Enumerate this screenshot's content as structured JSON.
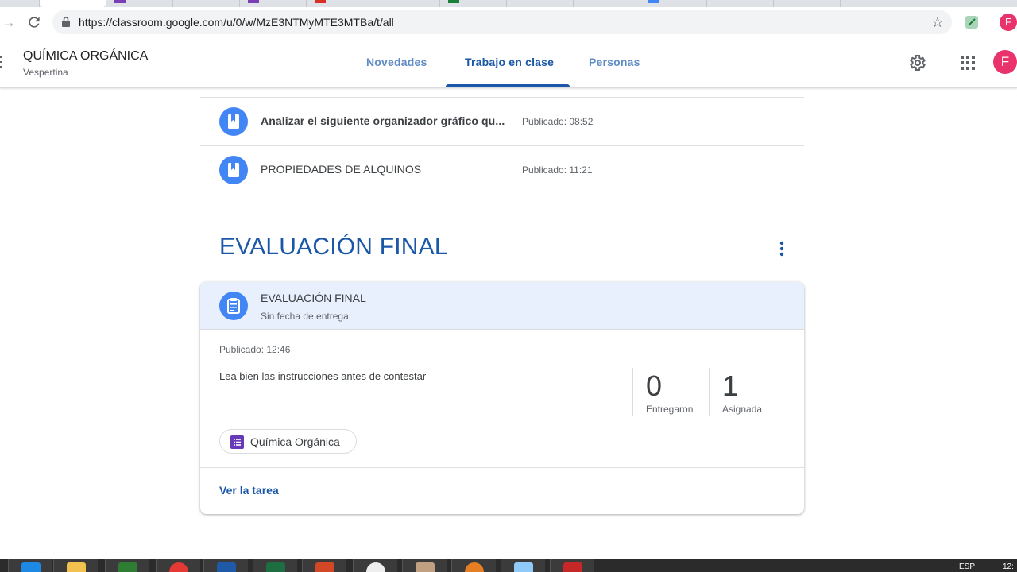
{
  "browser": {
    "url": "https://classroom.google.com/u/0/w/MzE3NTMyMTE3MTBa/t/all",
    "profile_initial": "F"
  },
  "header": {
    "course_title": "QUÍMICA ORGÁNICA",
    "course_subtitle": "Vespertina",
    "tabs": [
      {
        "label": "Novedades"
      },
      {
        "label": "Trabajo en clase"
      },
      {
        "label": "Personas"
      }
    ],
    "avatar_initial": "F"
  },
  "materials": [
    {
      "title": "Analizar el siguiente organizador gráfico qu...",
      "published": "Publicado: 08:52",
      "icon": "material-icon"
    },
    {
      "title": "PROPIEDADES DE ALQUINOS",
      "published": "Publicado: 11:21",
      "icon": "material-icon"
    }
  ],
  "section": {
    "title": "EVALUACIÓN FINAL"
  },
  "assignment": {
    "title": "EVALUACIÓN FINAL",
    "due": "Sin fecha de entrega",
    "published": "Publicado: 12:46",
    "description": "Lea bien las instrucciones antes de contestar",
    "stats": [
      {
        "value": "0",
        "label": "Entregaron"
      },
      {
        "value": "1",
        "label": "Asignada"
      }
    ],
    "attachment": "Química Orgánica",
    "view_link": "Ver la tarea"
  },
  "taskbar": {
    "lang": "ESP",
    "time": "12:"
  },
  "colors": {
    "accent": "#1a57a8",
    "icon_blue": "#4285f4",
    "avatar": "#e8336d",
    "forms_purple": "#673ab7"
  }
}
